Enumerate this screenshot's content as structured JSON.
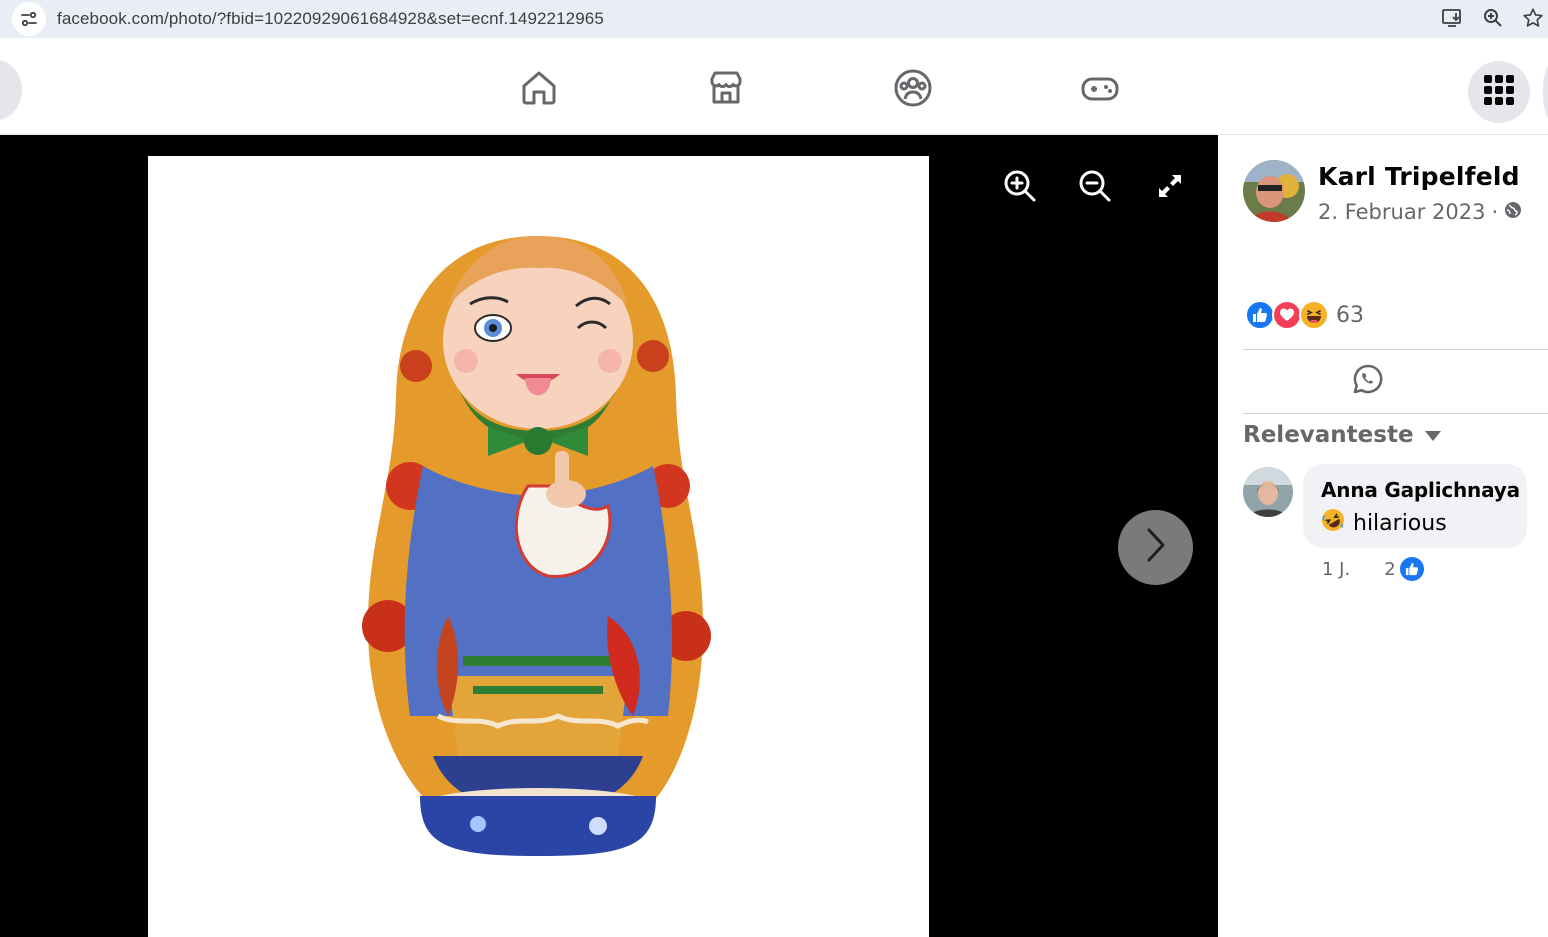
{
  "browser": {
    "url": "facebook.com/photo/?fbid=10220929061684928&set=ecnf.1492212965"
  },
  "nav": {
    "tabs": [
      "home",
      "marketplace",
      "groups",
      "gaming"
    ]
  },
  "post": {
    "author": "Karl Tripelfeld",
    "date": "2. Februar 2023",
    "separator": "·",
    "reaction_count": "63"
  },
  "comments": {
    "sort_label": "Relevanteste",
    "items": [
      {
        "author": "Anna Gaplichnaya",
        "emoji": "🤣",
        "text": "hilarious",
        "time": "1 J.",
        "likes": "2"
      }
    ]
  },
  "colors": {
    "facebook_blue": "#1877f2",
    "love_red": "#f33e58",
    "haha_yellow": "#f7b125",
    "viewer_bg": "#000000"
  }
}
